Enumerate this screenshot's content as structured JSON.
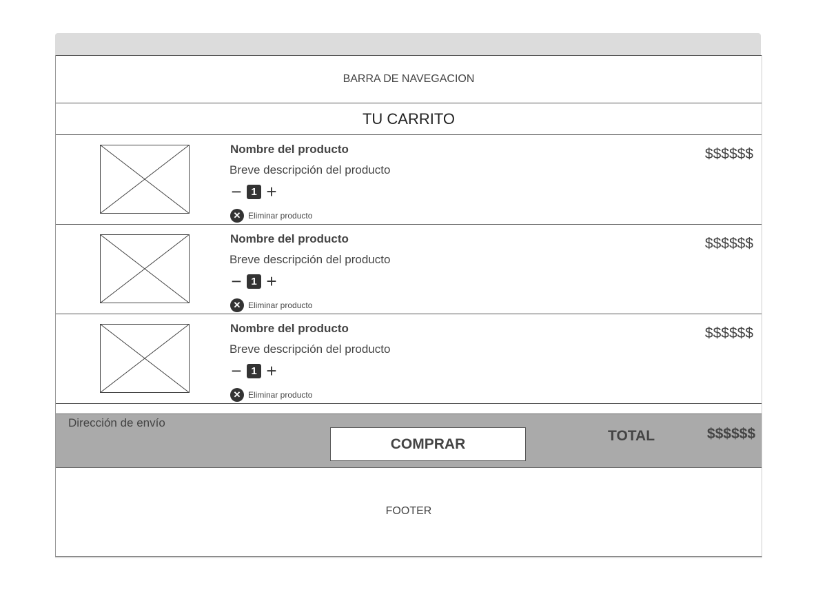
{
  "navbar": {
    "label": "BARRA DE NAVEGACION"
  },
  "cart": {
    "title": "TU CARRITO",
    "items": [
      {
        "name": "Nombre del producto",
        "description": "Breve descripción del producto",
        "quantity": "1",
        "minus": "−",
        "plus": "+",
        "remove_label": "Eliminar producto",
        "price": "$$$$$$"
      },
      {
        "name": "Nombre del producto",
        "description": "Breve descripción del producto",
        "quantity": "1",
        "minus": "−",
        "plus": "+",
        "remove_label": "Eliminar producto",
        "price": "$$$$$$"
      },
      {
        "name": "Nombre del producto",
        "description": "Breve descripción del producto",
        "quantity": "1",
        "minus": "−",
        "plus": "+",
        "remove_label": "Eliminar producto",
        "price": "$$$$$$"
      }
    ]
  },
  "checkout": {
    "address_label": "Dirección de envío",
    "buy_label": "COMPRAR",
    "total_label": "TOTAL",
    "total_value": "$$$$$$",
    "background": "#aaaaaa"
  },
  "footer": {
    "label": "FOOTER"
  },
  "icons": {
    "placeholder": "image-placeholder-icon",
    "remove": "close-circle-icon",
    "minus": "minus-icon",
    "plus": "plus-icon"
  }
}
